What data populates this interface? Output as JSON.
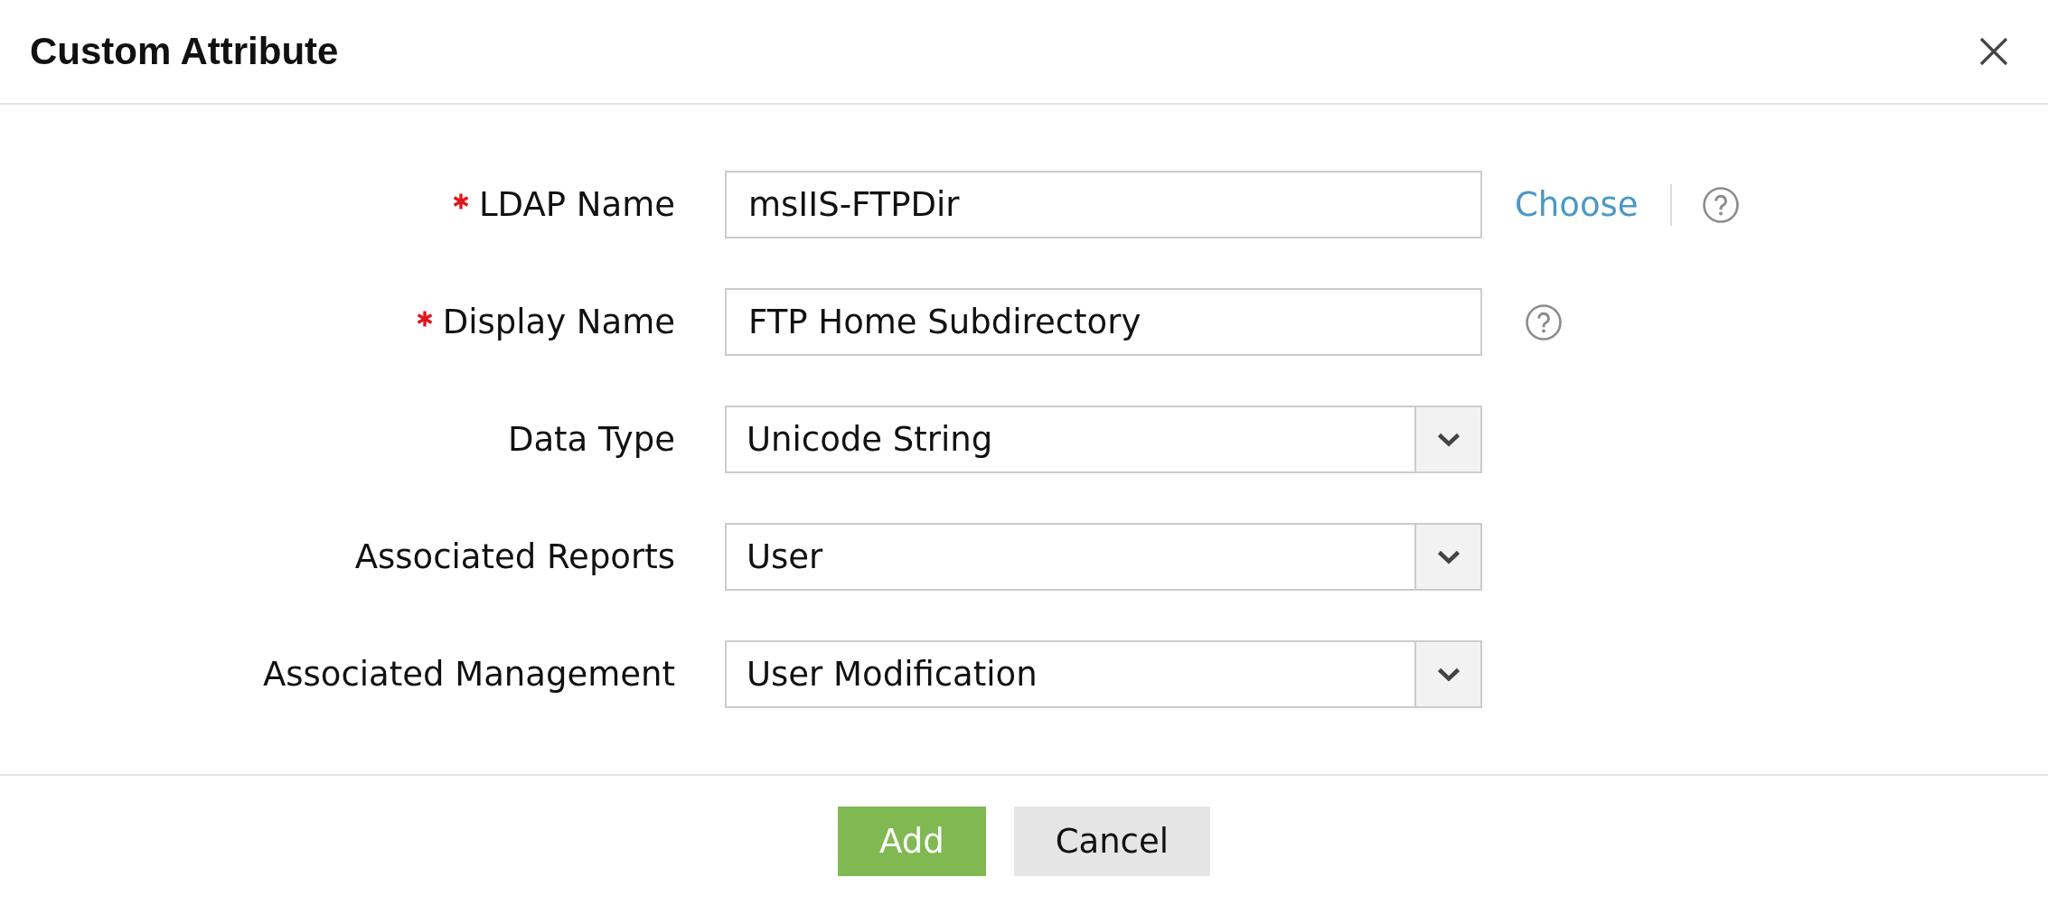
{
  "dialog": {
    "title": "Custom Attribute"
  },
  "fields": [
    {
      "kind": "text",
      "label": "LDAP Name",
      "required": true,
      "value": "msIIS-FTPDir",
      "link": "Choose",
      "help": true
    },
    {
      "kind": "text",
      "label": "Display Name",
      "required": true,
      "value": "FTP Home Subdirectory",
      "help": true
    },
    {
      "kind": "select",
      "label": "Data Type",
      "required": false,
      "value": "Unicode String",
      "help": false
    },
    {
      "kind": "select",
      "label": "Associated Reports",
      "required": false,
      "value": "User",
      "help": false
    },
    {
      "kind": "select",
      "label": "Associated Management",
      "required": false,
      "value": "User Modification",
      "help": false
    }
  ],
  "buttons": [
    {
      "label": "Add",
      "kind": "primary"
    },
    {
      "label": "Cancel",
      "kind": "secondary"
    }
  ]
}
